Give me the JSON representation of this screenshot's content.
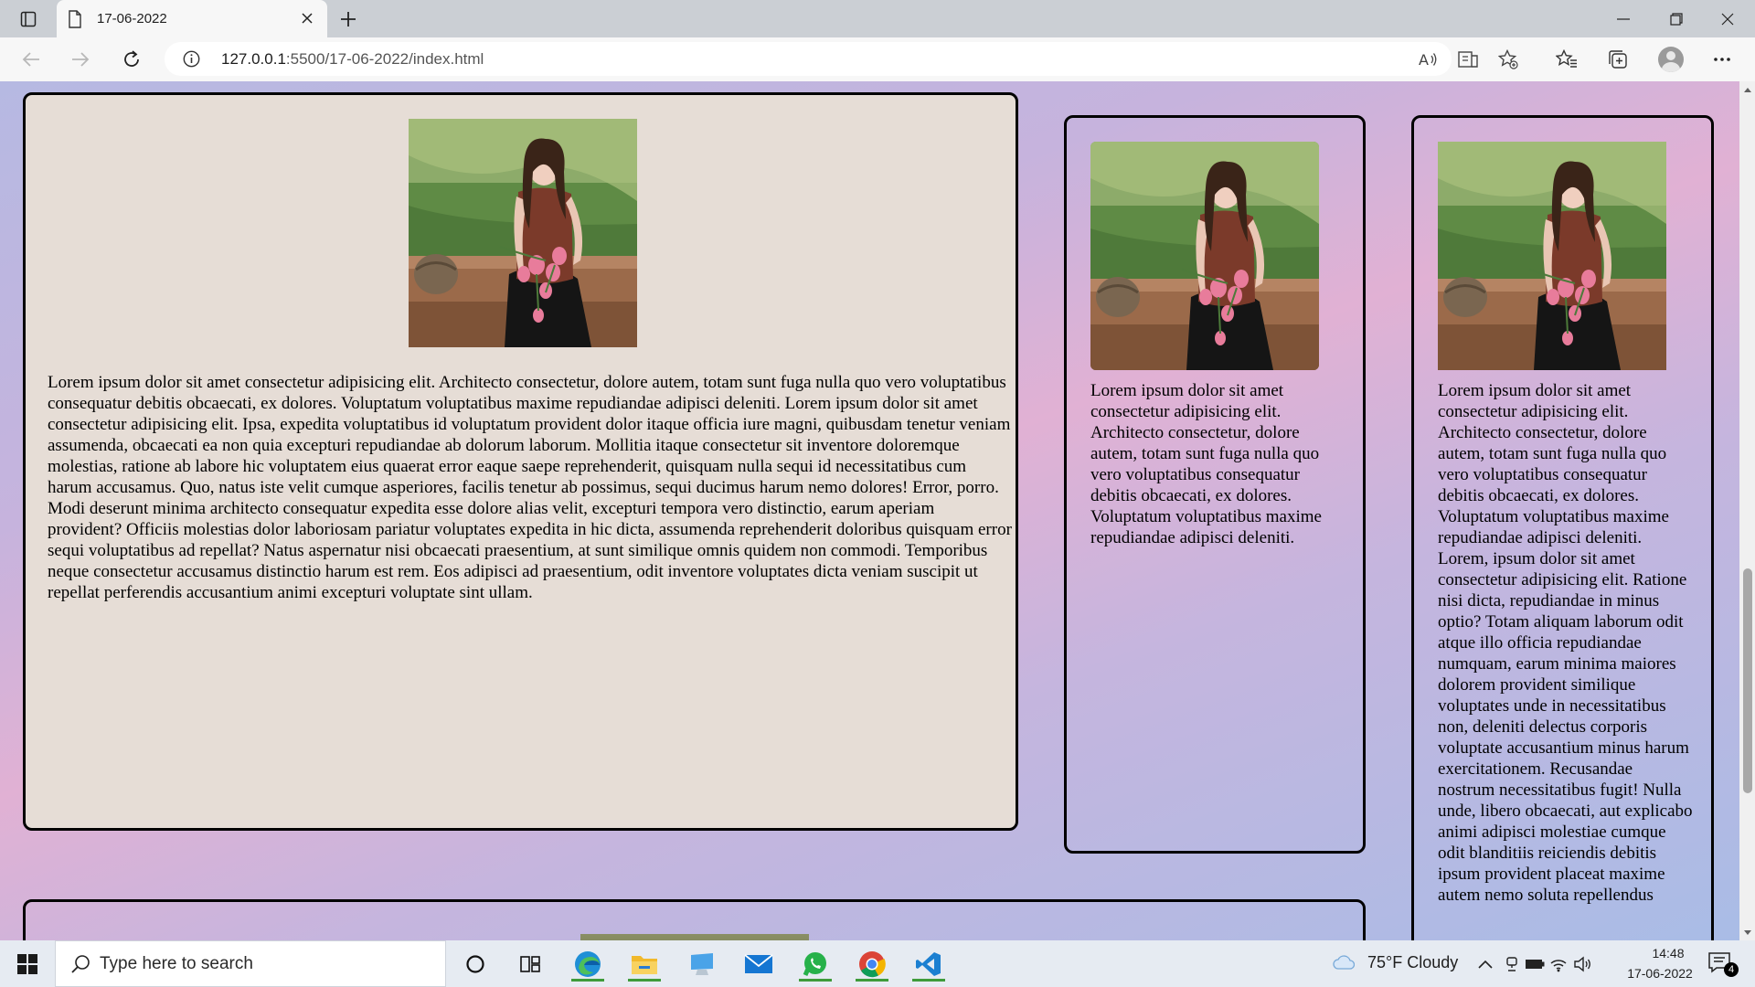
{
  "browser": {
    "tab_title": "17-06-2022",
    "url_host": "127.0.0.1",
    "url_rest": ":5500/17-06-2022/index.html"
  },
  "icons": {
    "tab_actions": "tab-actions-icon",
    "page": "page-icon",
    "close": "close-icon",
    "new_tab": "plus-icon",
    "minimize": "minimize-icon",
    "restore": "restore-icon",
    "back": "back-arrow-icon",
    "forward": "forward-arrow-icon",
    "refresh": "refresh-icon",
    "info": "info-icon",
    "read_aloud": "read-aloud-icon",
    "immersive_reader": "immersive-reader-icon",
    "add_favorite": "add-favorite-icon",
    "favorites": "favorites-icon",
    "collections": "collections-icon",
    "profile": "profile-avatar",
    "more": "more-icon",
    "start": "windows-logo-icon",
    "search": "search-icon",
    "cortana": "cortana-icon",
    "task_view": "task-view-icon",
    "edge": "edge-icon",
    "file_explorer": "folder-icon",
    "computer": "computer-icon",
    "mail": "mail-icon",
    "whatsapp": "whatsapp-icon",
    "chrome": "chrome-icon",
    "vscode": "vscode-icon",
    "weather": "cloud-icon",
    "chevron_up": "chevron-up-icon",
    "notifications": "notification-icon"
  },
  "colors": {
    "card_main_bg": "#e6ddd6",
    "card_border": "#000000",
    "gradient_pink": "#e1b1d4",
    "gradient_blue": "#a9bce6"
  },
  "cards": {
    "main_text": "Lorem ipsum dolor sit amet consectetur adipisicing elit. Architecto consectetur, dolore autem, totam sunt fuga nulla quo vero voluptatibus consequatur debitis obcaecati, ex dolores. Voluptatum voluptatibus maxime repudiandae adipisci deleniti. Lorem ipsum dolor sit amet consectetur adipisicing elit. Ipsa, expedita voluptatibus id voluptatum provident dolor itaque officia iure magni, quibusdam tenetur veniam assumenda, obcaecati ea non quia excepturi repudiandae ab dolorum laborum. Mollitia itaque consectetur sit inventore doloremque molestias, ratione ab labore hic voluptatem eius quaerat error eaque saepe reprehenderit, quisquam nulla sequi id necessitatibus cum harum accusamus. Quo, natus iste velit cumque asperiores, facilis tenetur ab possimus, sequi ducimus harum nemo dolores! Error, porro. Modi deserunt minima architecto consequatur expedita esse dolore alias velit, excepturi tempora vero distinctio, earum aperiam provident? Officiis molestias dolor laboriosam pariatur voluptates expedita in hic dicta, assumenda reprehenderit doloribus quisquam error sequi voluptatibus ad repellat? Natus aspernatur nisi obcaecati praesentium, at sunt similique omnis quidem non commodi. Temporibus neque consectetur accusamus distinctio harum est rem. Eos adipisci ad praesentium, odit inventore voluptates dicta veniam suscipit ut repellat perferendis accusantium animi excepturi voluptate sint ullam.",
    "side1_text": "Lorem ipsum dolor sit amet consectetur adipisicing elit. Architecto consectetur, dolore autem, totam sunt fuga nulla quo vero voluptatibus consequatur debitis obcaecati, ex dolores. Voluptatum voluptatibus maxime repudiandae adipisci deleniti.",
    "side2_text": "Lorem ipsum dolor sit amet consectetur adipisicing elit. Architecto consectetur, dolore autem, totam sunt fuga nulla quo vero voluptatibus consequatur debitis obcaecati, ex dolores. Voluptatum voluptatibus maxime repudiandae adipisci deleniti. Lorem, ipsum dolor sit amet consectetur adipisicing elit. Ratione nisi dicta, repudiandae in minus optio? Totam aliquam laborum odit atque illo officia repudiandae numquam, earum minima maiores dolorem provident similique voluptates unde in necessitatibus non, deleniti delectus corporis voluptate accusantium minus harum exercitationem. Recusandae nostrum necessitatibus fugit! Nulla unde, libero obcaecati, aut explicabo animi adipisci molestiae cumque odit blanditiis reiciendis debitis ipsum provident placeat maxime autem nemo soluta repellendus"
  },
  "taskbar": {
    "search_placeholder": "Type here to search",
    "weather": "75°F  Cloudy",
    "time": "14:48",
    "date": "17-06-2022",
    "notification_count": "4"
  }
}
